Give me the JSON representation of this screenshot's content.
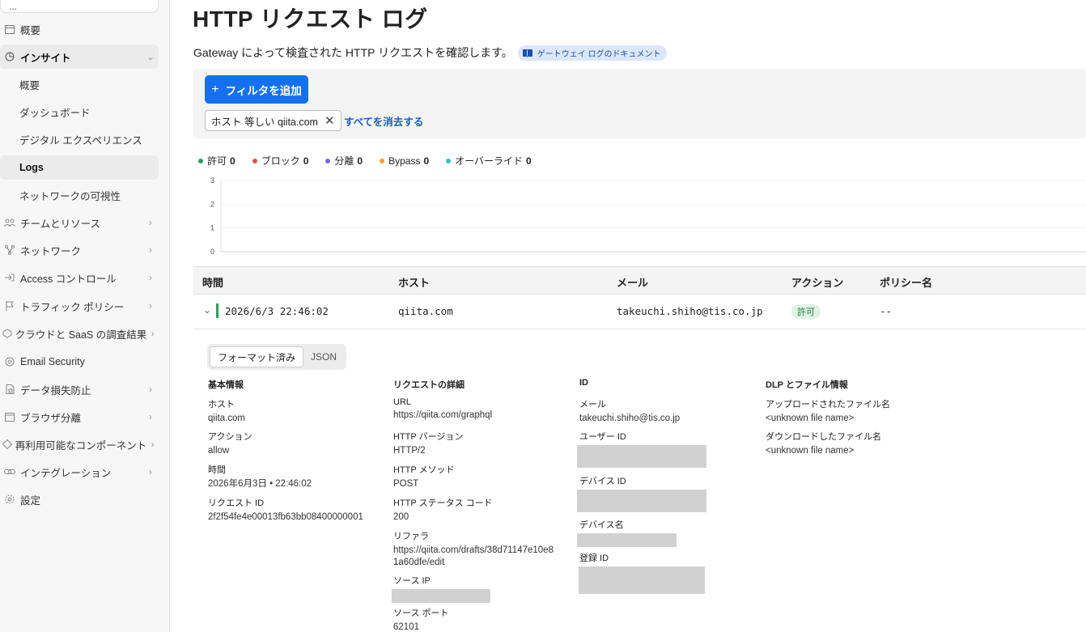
{
  "sidebar": {
    "account_name": "...",
    "items": [
      {
        "label": "概要",
        "icon": "window-icon"
      },
      {
        "label": "インサイト",
        "icon": "chart-icon"
      },
      {
        "label": "概要"
      },
      {
        "label": "ダッシュボード"
      },
      {
        "label": "デジタル エクスペリエンス"
      },
      {
        "label": "Logs"
      },
      {
        "label": "ネットワークの可視性"
      },
      {
        "label": "チームとリソース",
        "icon": "team-icon"
      },
      {
        "label": "ネットワーク",
        "icon": "network-icon"
      },
      {
        "label": "Access コントロール",
        "icon": "access-icon"
      },
      {
        "label": "トラフィック ポリシー",
        "icon": "traffic-icon"
      },
      {
        "label": "クラウドと SaaS の調査結果",
        "icon": "cloud-icon"
      },
      {
        "label": "Email Security",
        "icon": "email-icon"
      },
      {
        "label": "データ損失防止",
        "icon": "dlp-icon"
      },
      {
        "label": "ブラウザ分離",
        "icon": "browser-icon"
      },
      {
        "label": "再利用可能なコンポーネント",
        "icon": "component-icon"
      },
      {
        "label": "インテグレーション",
        "icon": "integration-icon"
      },
      {
        "label": "設定",
        "icon": "gear-icon"
      }
    ]
  },
  "header": {
    "title": "HTTP リクエスト ログ",
    "subtitle": "Gateway によって検査された HTTP リクエストを確認します。",
    "doc_link": "ゲートウェイ ログのドキュメント"
  },
  "filters": {
    "add_button": "フィルタを追加",
    "chip_label": "ホスト 等しい qiita.com",
    "clear_all": "すべてを消去する"
  },
  "legend": [
    {
      "label": "許可",
      "count": "0",
      "color": "#2e9e59"
    },
    {
      "label": "ブロック",
      "count": "0",
      "color": "#e2533f"
    },
    {
      "label": "分離",
      "count": "0",
      "color": "#7b61ff"
    },
    {
      "label": "Bypass",
      "count": "0",
      "color": "#f0a32c"
    },
    {
      "label": "オーバーライド",
      "count": "0",
      "color": "#39c2c0"
    }
  ],
  "chart_data": {
    "type": "line",
    "y_ticks": [
      "3",
      "2",
      "1",
      "0"
    ],
    "ylim": [
      0,
      3
    ],
    "series": []
  },
  "table": {
    "headers": {
      "time": "時間",
      "host": "ホスト",
      "email": "メール",
      "action": "アクション",
      "policy": "ポリシー名"
    },
    "row": {
      "time": "2026/6/3 22:46:02",
      "host": "qiita.com",
      "email": "takeuchi.shiho@tis.co.jp",
      "action": "許可",
      "policy": "--"
    }
  },
  "detail": {
    "tabs": {
      "formatted": "フォーマット済み",
      "json": "JSON"
    },
    "basic": {
      "heading": "基本情報",
      "host_k": "ホスト",
      "host_v": "qiita.com",
      "action_k": "アクション",
      "action_v": "allow",
      "time_k": "時間",
      "time_v": "2026年6月3日 • 22:46:02",
      "reqid_k": "リクエスト ID",
      "reqid_v": "2f2f54fe4e00013fb63bb08400000001"
    },
    "request": {
      "heading": "リクエストの詳細",
      "url_k": "URL",
      "url_v": "https://qiita.com/graphql",
      "ver_k": "HTTP バージョン",
      "ver_v": "HTTP/2",
      "method_k": "HTTP メソッド",
      "method_v": "POST",
      "status_k": "HTTP ステータス コード",
      "status_v": "200",
      "ref_k": "リファラ",
      "ref_v": "https://qiita.com/drafts/38d71147e10e81a60dfe/edit",
      "srcip_k": "ソース IP",
      "srcport_k": "ソース ポート",
      "srcport_v": "62101"
    },
    "identity": {
      "heading": "ID",
      "email_k": "メール",
      "email_v": "takeuchi.shiho@tis.co.jp",
      "userid_k": "ユーザー ID",
      "deviceid_k": "デバイス ID",
      "devicename_k": "デバイス名",
      "regid_k": "登録 ID"
    },
    "dlp": {
      "heading": "DLP とファイル情報",
      "upload_k": "アップロードされたファイル名",
      "upload_v": "<unknown file name>",
      "download_k": "ダウンロードしたファイル名",
      "download_v": "<unknown file name>"
    }
  }
}
